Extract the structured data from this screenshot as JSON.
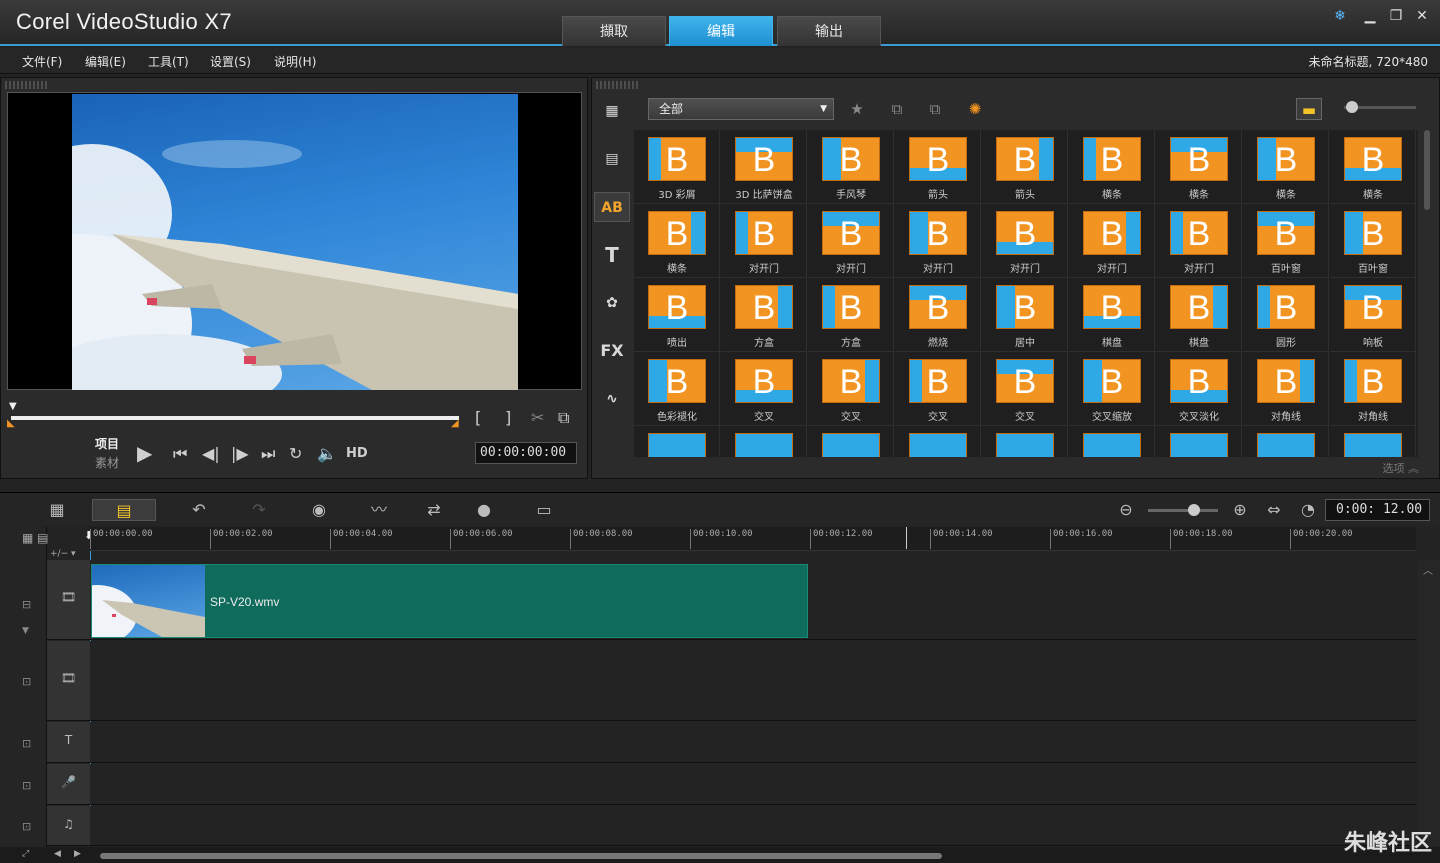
{
  "app": {
    "title": "Corel VideoStudio X7"
  },
  "main_tabs": [
    {
      "label": "擷取"
    },
    {
      "label": "编辑"
    },
    {
      "label": "输出"
    }
  ],
  "menu": [
    {
      "label": "文件(F)"
    },
    {
      "label": "编辑(E)"
    },
    {
      "label": "工具(T)"
    },
    {
      "label": "设置(S)"
    },
    {
      "label": "说明(H)"
    }
  ],
  "project_info": "未命名标题, 720*480",
  "player": {
    "mode_project": "项目",
    "mode_clip": "素材",
    "hd_label": "HD",
    "timecode": "00:00:00:00",
    "mark_in": "[",
    "mark_out": "]"
  },
  "library": {
    "category": "全部",
    "side_icons": [
      "media-icon",
      "instant-project-icon",
      "transition-icon",
      "title-icon",
      "graphic-icon",
      "filter-icon",
      "path-icon"
    ],
    "side_labels": {
      "transition": "AB",
      "title": "T",
      "filter": "FX"
    },
    "options_label": "选项",
    "transitions": [
      {
        "label": "3D 彩屑"
      },
      {
        "label": "3D 比萨饼盒"
      },
      {
        "label": "手风琴"
      },
      {
        "label": "箭头"
      },
      {
        "label": "箭头"
      },
      {
        "label": "横条"
      },
      {
        "label": "横条"
      },
      {
        "label": "横条"
      },
      {
        "label": "横条"
      },
      {
        "label": "横条"
      },
      {
        "label": "对开门"
      },
      {
        "label": "对开门"
      },
      {
        "label": "对开门"
      },
      {
        "label": "对开门"
      },
      {
        "label": "对开门"
      },
      {
        "label": "对开门"
      },
      {
        "label": "百叶窗"
      },
      {
        "label": "百叶窗"
      },
      {
        "label": "喷出"
      },
      {
        "label": "方盒"
      },
      {
        "label": "方盒"
      },
      {
        "label": "燃烧"
      },
      {
        "label": "居中"
      },
      {
        "label": "棋盘"
      },
      {
        "label": "棋盘"
      },
      {
        "label": "圆形"
      },
      {
        "label": "响板"
      },
      {
        "label": "色彩褪化"
      },
      {
        "label": "交叉"
      },
      {
        "label": "交叉"
      },
      {
        "label": "交叉"
      },
      {
        "label": "交叉"
      },
      {
        "label": "交叉缩放"
      },
      {
        "label": "交叉淡化"
      },
      {
        "label": "对角线"
      },
      {
        "label": "对角线"
      }
    ]
  },
  "timeline": {
    "timecode": "0:00: 12.00",
    "ruler": [
      "00:00:00.00",
      "00:00:02.00",
      "00:00:04.00",
      "00:00:06.00",
      "00:00:08.00",
      "00:00:10.00",
      "00:00:12.00",
      "00:00:14.00",
      "00:00:16.00",
      "00:00:18.00",
      "00:00:20.00"
    ],
    "clip_name": "SP-V20.wmv"
  },
  "watermark": "朱峰社区"
}
